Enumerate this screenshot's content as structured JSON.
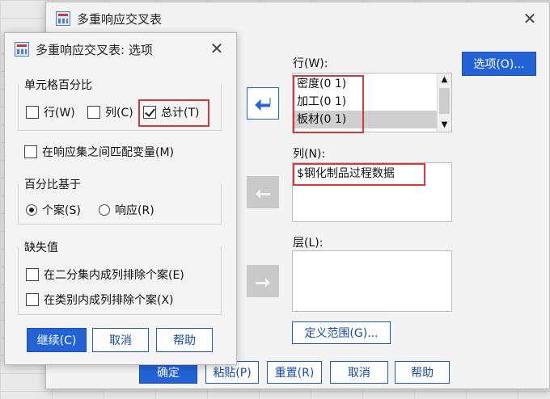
{
  "main_dialog": {
    "title": "多重响应交叉表",
    "rows_label": "行(W):",
    "rows_items": [
      "密度(0 1)",
      "加工(0 1)",
      "板材(0 1)"
    ],
    "cols_label": "列(N):",
    "cols_items": [
      "$钢化制品过程数据"
    ],
    "layers_label": "层(L):",
    "options_button": "选项(O)...",
    "define_ranges_button": "定义范围(G)...",
    "buttons": {
      "ok": "确定",
      "paste": "粘贴(P)",
      "reset": "重置(R)",
      "cancel": "取消",
      "help": "帮助"
    }
  },
  "options_dialog": {
    "title": "多重响应交叉表: 选项",
    "cell_percent_group": "单元格百分比",
    "row_checkbox": "行(W)",
    "col_checkbox": "列(C)",
    "total_checkbox": "总计(T)",
    "match_vars_checkbox": "在响应集之间匹配变量(M)",
    "percent_based_group": "百分比基于",
    "radio_cases": "个案(S)",
    "radio_responses": "响应(R)",
    "missing_group": "缺失值",
    "missing_dichotomy": "在二分集内成列排除个案(E)",
    "missing_category": "在类别内成列排除个案(X)",
    "continue_button": "继续(C)",
    "cancel_button": "取消",
    "help_button": "帮助"
  }
}
